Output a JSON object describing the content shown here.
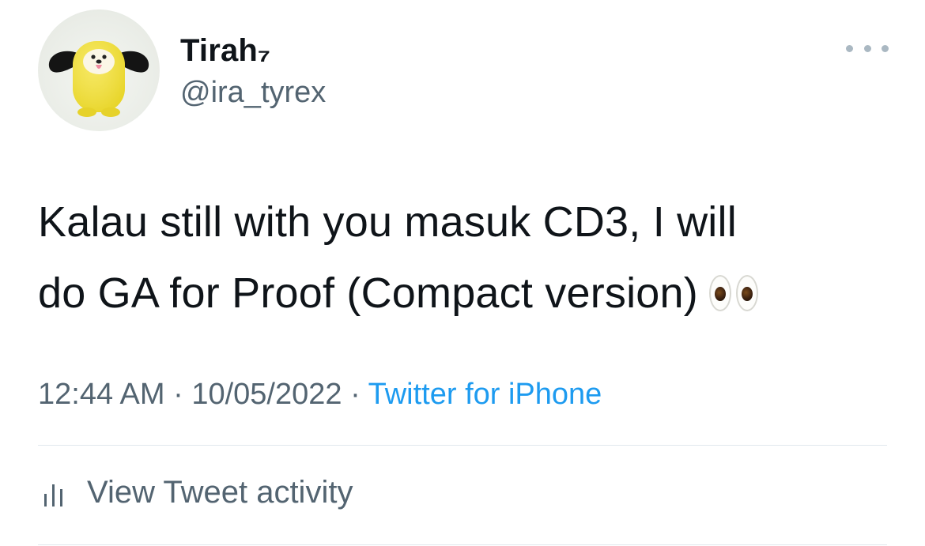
{
  "author": {
    "name": "Tirah₇",
    "handle": "@ira_tyrex",
    "avatar_icon": "chimmy-plush-avatar"
  },
  "more_icon": "more-horizontal-icon",
  "tweet": {
    "text": "Kalau still with you masuk CD3, I will\ndo GA for Proof (Compact version)",
    "emoji": "eyes-emoji"
  },
  "meta": {
    "time": "12:44 AM",
    "separator": " · ",
    "date": "10/05/2022",
    "source": "Twitter for iPhone"
  },
  "activity": {
    "icon": "bar-chart-icon",
    "label": "View Tweet activity"
  },
  "colors": {
    "text_primary": "#0f1419",
    "text_secondary": "#536471",
    "link": "#1d9bf0",
    "divider": "#e1e8ed"
  }
}
